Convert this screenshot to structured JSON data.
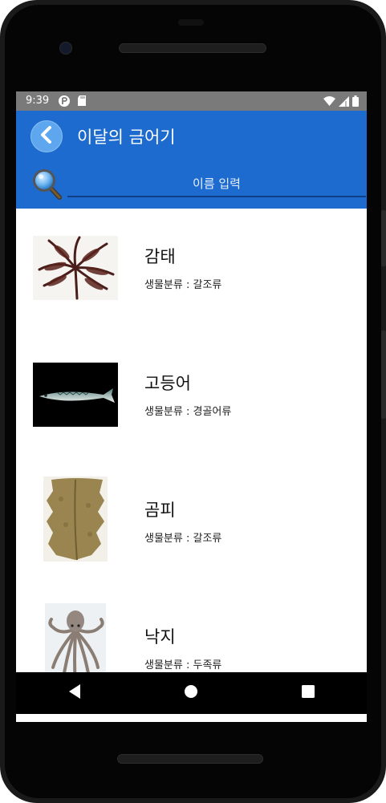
{
  "status_bar": {
    "time": "9:39",
    "left_icons": [
      "notification-icon",
      "sd-card-icon"
    ],
    "right_icons": [
      "wifi-icon",
      "signal-icon",
      "battery-icon"
    ]
  },
  "app_bar": {
    "title": "이달의 금어기",
    "back_icon": "chevron-left-icon",
    "color": "#1e6bcf"
  },
  "search": {
    "placeholder": "이름 입력",
    "value": "",
    "icon": "magnifier-icon"
  },
  "list": {
    "items": [
      {
        "name": "감태",
        "category": "생물분류 : 갈조류",
        "thumb": "seaweed-image"
      },
      {
        "name": "고등어",
        "category": "생물분류 : 경골어류",
        "thumb": "mackerel-image"
      },
      {
        "name": "곰피",
        "category": "생물분류 : 갈조류",
        "thumb": "kelp-image"
      },
      {
        "name": "낙지",
        "category": "생물분류 : 두족류",
        "thumb": "octopus-image"
      }
    ]
  },
  "nav_bar": {
    "buttons": [
      "back-triangle-icon",
      "home-circle-icon",
      "recents-square-icon"
    ]
  }
}
